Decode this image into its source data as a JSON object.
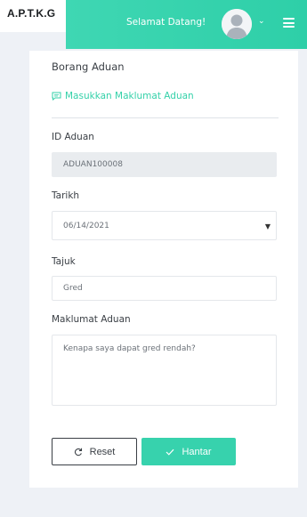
{
  "brand": {
    "name": "A.P.T.K.G"
  },
  "header": {
    "welcome": "Selamat Datang!"
  },
  "form": {
    "title": "Borang Aduan",
    "section_label": "Masukkan Maklumat Aduan",
    "id_label": "ID Aduan",
    "id_value": "ADUAN100008",
    "date_label": "Tarikh",
    "date_value": "06/14/2021",
    "subject_label": "Tajuk",
    "subject_value": "Gred",
    "details_label": "Maklumat Aduan",
    "details_value": "Kenapa saya dapat gred rendah?",
    "reset_label": "Reset",
    "submit_label": "Hantar"
  },
  "colors": {
    "accent": "#37d2ad",
    "header_gradient_start": "#3fd7b3",
    "background": "#eef1f6"
  },
  "icons": {
    "section": "message-icon",
    "reset": "refresh-icon",
    "submit": "check-icon",
    "menu": "hamburger-menu-icon",
    "user": "user-avatar-icon",
    "dropdown": "chevron-down-icon"
  }
}
